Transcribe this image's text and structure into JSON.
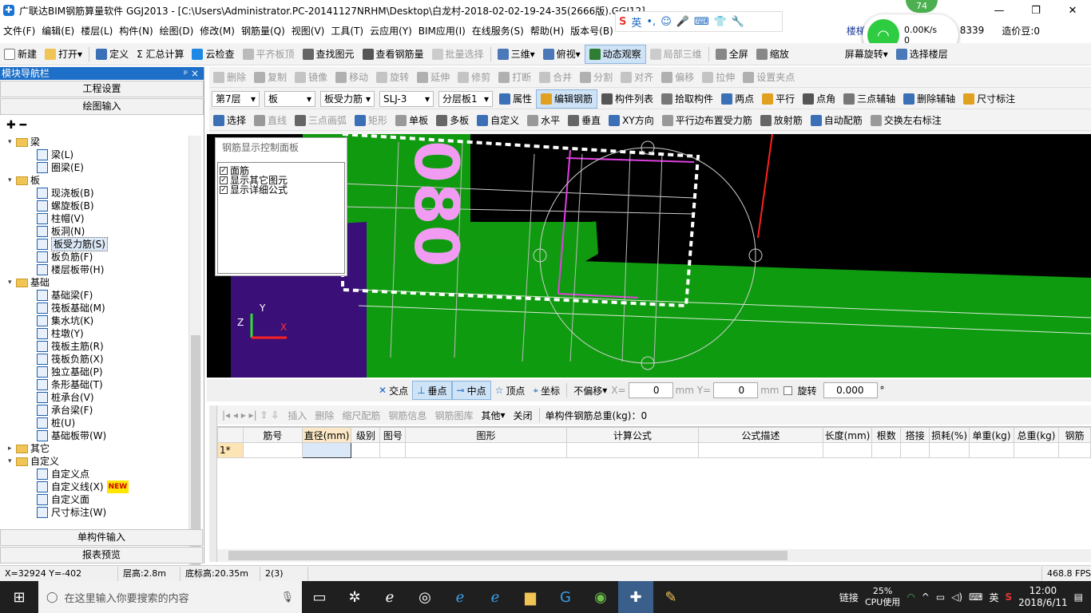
{
  "window": {
    "title": "广联达BIM钢筋算量软件 GGJ2013 - [C:\\Users\\Administrator.PC-20141127NRHM\\Desktop\\白龙村-2018-02-02-19-24-35(2666版).GGJ12]",
    "buttons": [
      "—",
      "❐",
      "✕"
    ]
  },
  "menu": [
    "文件(F)",
    "编辑(E)",
    "楼层(L)",
    "构件(N)",
    "绘图(D)",
    "修改(M)",
    "钢筋量(Q)",
    "视图(V)",
    "工具(T)",
    "云应用(Y)",
    "BIM应用(I)",
    "在线服务(S)",
    "帮助(H)",
    "版本号(B)"
  ],
  "menu_right": {
    "notice": "楼梯里高端平板净长是",
    "number": "8339",
    "price": "造价豆:0"
  },
  "toolbar1": [
    "新建",
    "打开",
    "定义",
    "Σ 汇总计算",
    "云检查",
    "平齐板顶",
    "查找图元",
    "查看钢筋量",
    "批量选择",
    "三维",
    "俯视",
    "动态观察",
    "局部三维",
    "全屏",
    "缩放",
    "屏幕旋转",
    "选择楼层"
  ],
  "left_panel": {
    "title": "模块导航栏",
    "pin": "ᵖ ×",
    "btn_project": "工程设置",
    "btn_draw": "绘图输入",
    "btn_single": "单构件输入",
    "btn_report": "报表预览",
    "tree": [
      {
        "level": 0,
        "label": "梁",
        "folder": true,
        "open": true
      },
      {
        "level": 1,
        "label": "梁(L)"
      },
      {
        "level": 1,
        "label": "圈梁(E)"
      },
      {
        "level": 0,
        "label": "板",
        "folder": true,
        "open": true
      },
      {
        "level": 1,
        "label": "现浇板(B)"
      },
      {
        "level": 1,
        "label": "螺旋板(B)"
      },
      {
        "level": 1,
        "label": "柱帽(V)"
      },
      {
        "level": 1,
        "label": "板洞(N)"
      },
      {
        "level": 1,
        "label": "板受力筋(S)",
        "selected": true
      },
      {
        "level": 1,
        "label": "板负筋(F)"
      },
      {
        "level": 1,
        "label": "楼层板带(H)"
      },
      {
        "level": 0,
        "label": "基础",
        "folder": true,
        "open": true
      },
      {
        "level": 1,
        "label": "基础梁(F)"
      },
      {
        "level": 1,
        "label": "筏板基础(M)"
      },
      {
        "level": 1,
        "label": "集水坑(K)"
      },
      {
        "level": 1,
        "label": "柱墩(Y)"
      },
      {
        "level": 1,
        "label": "筏板主筋(R)"
      },
      {
        "level": 1,
        "label": "筏板负筋(X)"
      },
      {
        "level": 1,
        "label": "独立基础(P)"
      },
      {
        "level": 1,
        "label": "条形基础(T)"
      },
      {
        "level": 1,
        "label": "桩承台(V)"
      },
      {
        "level": 1,
        "label": "承台梁(F)"
      },
      {
        "level": 1,
        "label": "桩(U)"
      },
      {
        "level": 1,
        "label": "基础板带(W)"
      },
      {
        "level": 0,
        "label": "其它",
        "folder": true,
        "open": false
      },
      {
        "level": 0,
        "label": "自定义",
        "folder": true,
        "open": true
      },
      {
        "level": 1,
        "label": "自定义点"
      },
      {
        "level": 1,
        "label": "自定义线(X)",
        "badge": "NEW"
      },
      {
        "level": 1,
        "label": "自定义面"
      },
      {
        "level": 1,
        "label": "尺寸标注(W)"
      }
    ]
  },
  "edit_bar": [
    "删除",
    "复制",
    "镜像",
    "移动",
    "旋转",
    "延伸",
    "修剪",
    "打断",
    "合并",
    "分割",
    "对齐",
    "偏移",
    "拉伸",
    "设置夹点"
  ],
  "prop_bar": {
    "floor": "第7层",
    "type": "板",
    "sub": "板受力筋",
    "item": "SLJ-3",
    "layer": "分层板1",
    "buttons": [
      "属性",
      "编辑钢筋",
      "构件列表",
      "拾取构件",
      "两点",
      "平行",
      "点角",
      "三点辅轴",
      "删除辅轴",
      "尺寸标注"
    ]
  },
  "draw_bar": [
    "选择",
    "直线",
    "三点画弧",
    "矩形",
    "单板",
    "多板",
    "自定义",
    "水平",
    "垂直",
    "XY方向",
    "平行边布置受力筋",
    "放射筋",
    "自动配筋",
    "交换左右标注"
  ],
  "control_panel": {
    "title": "钢筋显示控制面板",
    "items": [
      "面筋",
      "显示其它图元",
      "显示详细公式"
    ]
  },
  "viewport_text": "080",
  "snap_bar": {
    "items": [
      "交点",
      "垂点",
      "中点",
      "顶点",
      "坐标"
    ],
    "offset": "不偏移",
    "x_label": "X=",
    "x_val": "0",
    "y_label": "mm Y=",
    "y_val": "0",
    "mm": "mm",
    "rotate": "旋转",
    "rot_val": "0.000",
    "deg": "°"
  },
  "rebar_bar": {
    "items": [
      "插入",
      "删除",
      "缩尺配筋",
      "钢筋信息",
      "钢筋图库",
      "其他",
      "关闭"
    ],
    "total": "单构件钢筋总重(kg)：0"
  },
  "grid": {
    "columns": [
      "",
      "筋号",
      "直径(mm)",
      "级别",
      "图号",
      "图形",
      "计算公式",
      "公式描述",
      "长度(mm)",
      "根数",
      "搭接",
      "损耗(%)",
      "单重(kg)",
      "总重(kg)",
      "钢筋"
    ],
    "rows": [
      [
        "1*",
        "",
        "",
        "",
        "",
        "",
        "",
        "",
        "",
        "",
        "",
        "",
        "",
        "",
        ""
      ]
    ]
  },
  "status": {
    "coords": "X=32924 Y=-402",
    "floor_h": "层高:2.8m",
    "base_h": "底标高:20.35m",
    "count": "2(3)",
    "fps": "468.8 FPS"
  },
  "taskbar": {
    "search": "在这里输入你要搜索的内容",
    "link": "链接",
    "cpu_pct": "25%",
    "cpu": "CPU使用",
    "lang": "英",
    "time": "12:00",
    "date": "2018/6/11"
  },
  "overlay": {
    "net_speed": "0.00K/s",
    "net_down": "0",
    "net_score": "74",
    "ime_lang": "英"
  },
  "colors": {
    "accent": "#1e6fc8",
    "green": "#0c8a0c",
    "purple": "#3a1078"
  }
}
